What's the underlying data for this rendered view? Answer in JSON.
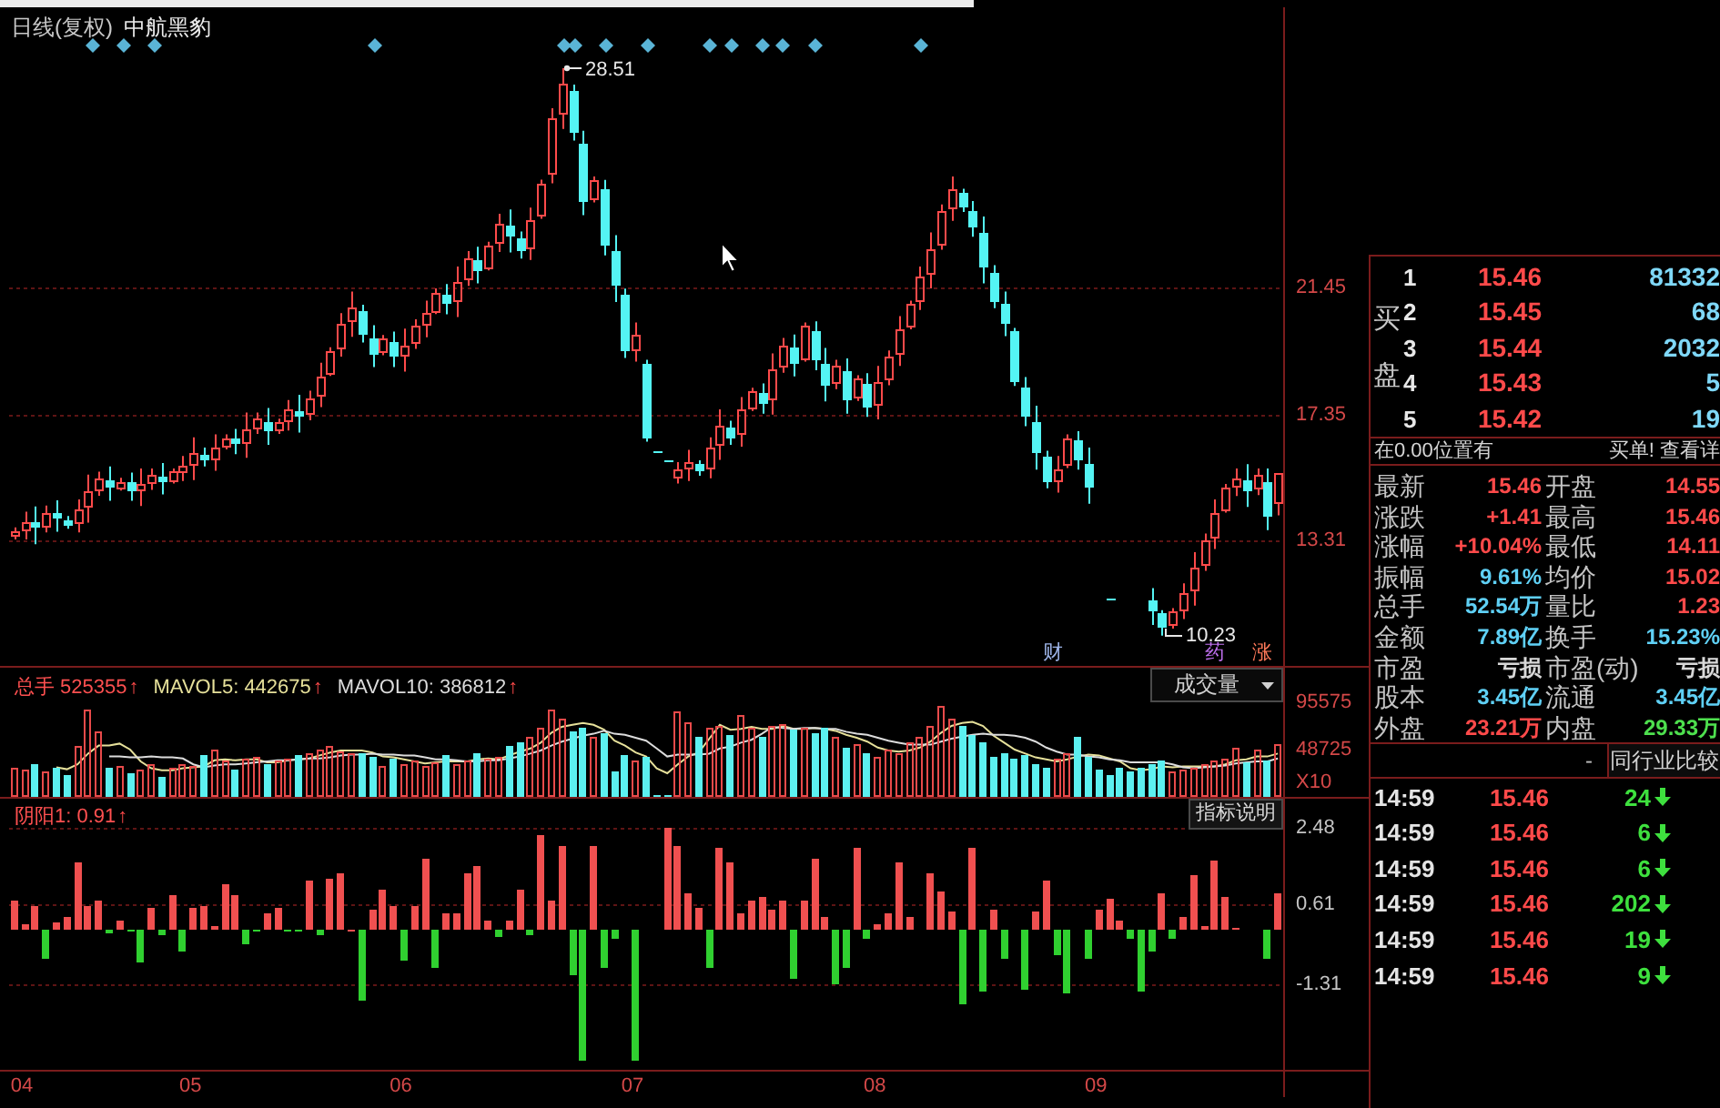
{
  "price_chart": {
    "title": "日线(复权)",
    "stock_name": "中航黑豹",
    "event_tags": [
      {
        "text": "财",
        "color": "#9db4e8"
      },
      {
        "text": "药",
        "color": "#c070f0"
      },
      {
        "text": "涨",
        "color": "#ff7a5a"
      }
    ],
    "chart_data": {
      "type": "candlestick",
      "grid": true,
      "ohlc": [
        [
          13.45,
          13.72,
          13.33,
          13.6
        ],
        [
          13.65,
          14.22,
          13.33,
          13.9
        ],
        [
          13.87,
          14.39,
          13.18,
          13.7
        ],
        [
          13.78,
          14.42,
          13.56,
          14.2
        ],
        [
          14.17,
          14.59,
          13.58,
          14.0
        ],
        [
          13.97,
          14.09,
          13.68,
          13.8
        ],
        [
          13.88,
          14.62,
          13.56,
          14.3
        ],
        [
          14.39,
          15.42,
          13.87,
          14.9
        ],
        [
          14.96,
          15.52,
          14.74,
          15.3
        ],
        [
          15.26,
          15.68,
          14.58,
          15.0
        ],
        [
          15.03,
          15.32,
          14.91,
          15.2
        ],
        [
          15.16,
          15.48,
          14.58,
          14.9
        ],
        [
          14.93,
          15.62,
          14.41,
          15.1
        ],
        [
          15.15,
          15.62,
          14.93,
          15.4
        ],
        [
          15.37,
          15.79,
          14.78,
          15.2
        ],
        [
          15.25,
          15.62,
          15.13,
          15.5
        ],
        [
          15.53,
          16.02,
          15.21,
          15.7
        ],
        [
          15.76,
          16.62,
          15.24,
          16.1
        ],
        [
          16.07,
          16.29,
          15.68,
          15.9
        ],
        [
          15.96,
          16.72,
          15.54,
          16.3
        ],
        [
          16.35,
          16.72,
          16.23,
          16.6
        ],
        [
          16.57,
          16.89,
          16.08,
          16.4
        ],
        [
          16.48,
          17.42,
          15.96,
          16.9
        ],
        [
          16.95,
          17.42,
          16.73,
          17.2
        ],
        [
          17.14,
          17.56,
          16.38,
          16.8
        ],
        [
          16.85,
          17.22,
          16.73,
          17.1
        ],
        [
          17.16,
          17.82,
          16.84,
          17.5
        ],
        [
          17.47,
          17.99,
          16.78,
          17.3
        ],
        [
          17.39,
          18.12,
          17.17,
          17.9
        ],
        [
          18.01,
          19.02,
          17.59,
          18.6
        ],
        [
          18.72,
          19.52,
          18.6,
          19.4
        ],
        [
          19.54,
          20.62,
          19.22,
          20.3
        ],
        [
          20.38,
          21.32,
          19.86,
          20.8
        ],
        [
          20.67,
          20.89,
          19.68,
          19.9
        ],
        [
          19.81,
          20.23,
          18.88,
          19.3
        ],
        [
          19.38,
          19.92,
          19.26,
          19.8
        ],
        [
          19.71,
          20.03,
          18.88,
          19.2
        ],
        [
          19.26,
          20.12,
          18.74,
          19.6
        ],
        [
          19.69,
          20.42,
          19.47,
          20.2
        ],
        [
          20.26,
          21.02,
          19.84,
          20.6
        ],
        [
          20.71,
          21.42,
          20.59,
          21.3
        ],
        [
          21.24,
          21.56,
          20.58,
          20.9
        ],
        [
          21.01,
          22.12,
          20.49,
          21.6
        ],
        [
          21.72,
          22.62,
          21.5,
          22.4
        ],
        [
          22.34,
          22.76,
          21.58,
          22.0
        ],
        [
          22.12,
          22.92,
          22.0,
          22.8
        ],
        [
          22.91,
          23.82,
          22.59,
          23.5
        ],
        [
          23.44,
          23.96,
          22.58,
          23.1
        ],
        [
          23.03,
          23.25,
          22.38,
          22.6
        ],
        [
          22.75,
          24.02,
          22.33,
          23.6
        ],
        [
          23.78,
          24.92,
          23.66,
          24.8
        ],
        [
          25.12,
          27.22,
          24.8,
          26.9
        ],
        [
          27.07,
          28.51,
          26.55,
          28.0
        ],
        [
          27.76,
          27.98,
          26.18,
          26.4
        ],
        [
          26.07,
          26.49,
          23.78,
          24.2
        ],
        [
          24.31,
          25.02,
          24.19,
          24.9
        ],
        [
          24.59,
          24.91,
          22.48,
          22.8
        ],
        [
          22.61,
          23.13,
          20.98,
          21.5
        ],
        [
          21.19,
          21.41,
          19.18,
          19.4
        ],
        [
          19.48,
          20.32,
          19.06,
          19.9
        ],
        [
          19.0,
          19.12,
          16.48,
          16.6
        ],
        [
          16.2,
          16.2,
          16.2,
          16.2
        ],
        [
          15.9,
          15.9,
          15.9,
          15.9
        ],
        [
          15.35,
          15.82,
          15.13,
          15.6
        ],
        [
          15.63,
          16.22,
          15.21,
          15.8
        ],
        [
          15.76,
          15.88,
          15.38,
          15.5
        ],
        [
          15.62,
          16.62,
          15.3,
          16.3
        ],
        [
          16.41,
          17.52,
          15.89,
          17.0
        ],
        [
          16.94,
          17.16,
          16.38,
          16.6
        ],
        [
          16.74,
          17.92,
          16.32,
          17.5
        ],
        [
          17.59,
          18.22,
          17.47,
          18.1
        ],
        [
          18.04,
          18.36,
          17.38,
          17.7
        ],
        [
          17.87,
          19.32,
          17.35,
          18.8
        ],
        [
          18.92,
          19.82,
          18.7,
          19.6
        ],
        [
          19.51,
          19.93,
          18.58,
          19.0
        ],
        [
          19.18,
          20.32,
          19.06,
          20.2
        ],
        [
          20.04,
          20.36,
          18.78,
          19.1
        ],
        [
          18.98,
          19.5,
          17.78,
          18.3
        ],
        [
          18.39,
          19.12,
          18.17,
          18.9
        ],
        [
          18.74,
          19.16,
          17.38,
          17.8
        ],
        [
          17.91,
          18.62,
          17.79,
          18.5
        ],
        [
          18.37,
          18.69,
          17.28,
          17.6
        ],
        [
          17.72,
          18.92,
          17.2,
          18.4
        ],
        [
          18.52,
          19.42,
          18.3,
          19.2
        ],
        [
          19.34,
          20.52,
          18.92,
          20.1
        ],
        [
          20.22,
          21.02,
          20.1,
          20.9
        ],
        [
          21.04,
          22.12,
          20.72,
          21.8
        ],
        [
          21.94,
          23.22,
          21.42,
          22.7
        ],
        [
          22.88,
          24.12,
          22.66,
          23.9
        ],
        [
          24.01,
          25.02,
          23.59,
          24.6
        ],
        [
          24.51,
          24.63,
          23.88,
          24.0
        ],
        [
          23.91,
          24.23,
          23.08,
          23.4
        ],
        [
          23.21,
          23.73,
          21.58,
          22.1
        ],
        [
          21.94,
          22.16,
          20.78,
          21.0
        ],
        [
          20.9,
          21.32,
          19.88,
          20.3
        ],
        [
          20.02,
          20.14,
          18.28,
          18.4
        ],
        [
          18.24,
          18.56,
          16.98,
          17.3
        ],
        [
          17.12,
          17.64,
          15.58,
          16.1
        ],
        [
          15.97,
          16.19,
          14.98,
          15.2
        ],
        [
          15.26,
          16.02,
          14.84,
          15.6
        ],
        [
          15.75,
          16.72,
          15.63,
          16.6
        ],
        [
          16.5,
          16.82,
          15.58,
          15.9
        ],
        [
          15.77,
          16.29,
          14.48,
          15.0
        ],
        null,
        [
          11.4,
          11.4,
          11.4,
          11.4
        ],
        null,
        null,
        null,
        [
          11.34,
          11.76,
          10.58,
          11.0
        ],
        [
          10.93,
          11.05,
          10.23,
          10.5
        ],
        [
          10.58,
          11.12,
          10.46,
          11.0
        ],
        [
          11.09,
          11.92,
          10.77,
          11.6
        ],
        [
          11.72,
          12.92,
          11.2,
          12.4
        ],
        [
          12.54,
          13.52,
          12.32,
          13.3
        ],
        [
          13.44,
          14.62,
          13.02,
          14.2
        ],
        [
          14.32,
          15.12,
          14.2,
          15.0
        ],
        [
          15.05,
          15.62,
          14.73,
          15.3
        ],
        [
          15.24,
          15.76,
          14.38,
          14.9
        ],
        [
          14.98,
          15.62,
          14.76,
          15.4
        ],
        [
          15.2,
          15.62,
          13.63,
          14.05
        ],
        [
          14.55,
          15.46,
          14.11,
          15.46
        ]
      ],
      "ylim": [
        9.26,
        30.47
      ],
      "yticks": [
        13.31,
        17.35,
        21.45
      ],
      "annotations": [
        {
          "text": "28.51"
        },
        {
          "text": "10.23"
        }
      ]
    }
  },
  "volume_panel": {
    "legend": [
      {
        "text": "总手 525355",
        "arrow": "↑",
        "color": "#ff5050"
      },
      {
        "text": "MAVOL5: 442675",
        "arrow": "↑",
        "color": "#e6e09a"
      },
      {
        "text": "MAVOL10: 386812",
        "arrow": "↑",
        "color": "#dcdcdc"
      }
    ],
    "dropdown": "成交量",
    "axis_unit": "X10",
    "chart_data": {
      "type": "bar",
      "stacked": true,
      "ylim": [
        0,
        131000
      ],
      "yticks": [
        48725,
        95575
      ],
      "series": [
        {
          "color": "#e84a4a",
          "values": [
            30000,
            28000,
            null,
            26000,
            null,
            null,
            52000,
            88000,
            66000,
            null,
            32000,
            null,
            28000,
            33000,
            null,
            30000,
            34000,
            31000,
            null,
            48000,
            36000,
            null,
            38000,
            40000,
            null,
            36000,
            38000,
            null,
            45000,
            48000,
            52000,
            46000,
            44000,
            null,
            null,
            32000,
            null,
            34000,
            36000,
            32000,
            35000,
            null,
            33000,
            36000,
            null,
            38000,
            40000,
            null,
            null,
            60000,
            70000,
            88000,
            80000,
            null,
            null,
            60000,
            null,
            null,
            null,
            36000,
            null,
            null,
            null,
            86000,
            75000,
            null,
            70000,
            72000,
            null,
            83000,
            70000,
            null,
            72000,
            74000,
            null,
            70000,
            null,
            null,
            60000,
            null,
            54000,
            null,
            40000,
            48000,
            45000,
            55000,
            60000,
            72000,
            92000,
            80000,
            null,
            null,
            null,
            null,
            null,
            null,
            null,
            null,
            null,
            38000,
            45000,
            null,
            null,
            null,
            null,
            null,
            null,
            null,
            null,
            null,
            26000,
            28000,
            30000,
            33000,
            36000,
            38000,
            50000,
            null,
            48000,
            null,
            53000
          ]
        },
        {
          "color": "#5cf0f0",
          "values": [
            null,
            null,
            34000,
            null,
            30000,
            22000,
            null,
            null,
            null,
            30000,
            null,
            24000,
            null,
            null,
            20000,
            null,
            null,
            null,
            42000,
            null,
            null,
            28000,
            null,
            null,
            34000,
            null,
            null,
            42000,
            null,
            null,
            null,
            null,
            null,
            45000,
            40000,
            null,
            38000,
            null,
            null,
            null,
            null,
            42000,
            null,
            null,
            44000,
            null,
            null,
            52000,
            55000,
            null,
            null,
            null,
            null,
            66000,
            70000,
            null,
            64000,
            25000,
            42000,
            null,
            40000,
            2000,
            2000,
            null,
            null,
            60000,
            null,
            null,
            62000,
            null,
            null,
            60000,
            null,
            null,
            68000,
            null,
            65000,
            70000,
            null,
            50000,
            null,
            45000,
            null,
            null,
            null,
            null,
            null,
            null,
            null,
            null,
            72000,
            62000,
            55000,
            40000,
            45000,
            38000,
            42000,
            34000,
            30000,
            null,
            null,
            60000,
            40000,
            28000,
            22000,
            30000,
            26000,
            30000,
            34000,
            36000,
            null,
            null,
            null,
            null,
            null,
            null,
            null,
            35000,
            null,
            36000,
            null
          ]
        },
        {
          "type": "line",
          "color": "#e6e09a",
          "values": [
            null,
            null,
            null,
            null,
            30000,
            28000,
            33000,
            44000,
            52000,
            52000,
            54000,
            48000,
            36000,
            29000,
            27000,
            27000,
            29000,
            30000,
            31000,
            37000,
            38000,
            37000,
            38000,
            38000,
            35000,
            35000,
            37000,
            38000,
            39000,
            42000,
            45000,
            47000,
            47000,
            47000,
            45000,
            41000,
            40000,
            38000,
            36000,
            34000,
            35000,
            36000,
            36000,
            36000,
            38000,
            39000,
            38000,
            42000,
            46000,
            49000,
            55000,
            65000,
            71000,
            73000,
            75000,
            73000,
            68000,
            57000,
            52000,
            45000,
            41000,
            29000,
            24000,
            33000,
            41000,
            45000,
            59000,
            73000,
            68000,
            69000,
            71000,
            69000,
            69000,
            72000,
            69000,
            69000,
            70000,
            69000,
            67000,
            63000,
            60000,
            56000,
            50000,
            47000,
            46000,
            47000,
            50000,
            56000,
            65000,
            72000,
            75000,
            76000,
            72000,
            62000,
            55000,
            48000,
            44000,
            40000,
            38000,
            36000,
            38000,
            41000,
            43000,
            42000,
            39000,
            36000,
            29000,
            27000,
            28000,
            31000,
            30000,
            31000,
            31000,
            31000,
            31000,
            33000,
            37000,
            38000,
            41000,
            41000,
            44000
          ]
        },
        {
          "type": "line",
          "color": "#dcdcdc",
          "values": [
            null,
            null,
            null,
            null,
            null,
            null,
            null,
            null,
            null,
            41000,
            41000,
            40000,
            40000,
            41000,
            40000,
            40000,
            39000,
            33000,
            30000,
            32000,
            33000,
            33000,
            34000,
            35000,
            36000,
            37000,
            37000,
            38000,
            39000,
            39000,
            40000,
            42000,
            43000,
            43000,
            44000,
            43000,
            43000,
            42000,
            42000,
            40000,
            38000,
            38000,
            37000,
            36000,
            36000,
            37000,
            37000,
            39000,
            41000,
            44000,
            47000,
            52000,
            56000,
            59000,
            62000,
            64000,
            67000,
            64000,
            63000,
            60000,
            57000,
            49000,
            41000,
            43000,
            43000,
            43000,
            44000,
            49000,
            51000,
            55000,
            58000,
            64000,
            71000,
            70000,
            69000,
            70000,
            70000,
            69000,
            69000,
            66000,
            64000,
            63000,
            60000,
            57000,
            55000,
            53000,
            53000,
            53000,
            56000,
            59000,
            61000,
            63000,
            64000,
            63000,
            63000,
            62000,
            60000,
            56000,
            50000,
            46000,
            43000,
            43000,
            41000,
            40000,
            38000,
            37000,
            35000,
            35000,
            35000,
            35000,
            33000,
            30000,
            29000,
            30000,
            31000,
            32000,
            34000,
            35000,
            36000,
            36000,
            39000
          ]
        }
      ]
    }
  },
  "indicator_panel": {
    "legend": {
      "text": "阴阳1: 0.91",
      "arrow": "↑"
    },
    "button": "指标说明",
    "chart_data": {
      "type": "bar",
      "grid": true,
      "ylim": [
        -3.4,
        3.2
      ],
      "yticks": [
        -1.31,
        0.61,
        2.48
      ],
      "series": [
        {
          "color": "#f05050",
          "values": [
            0.7,
            0.16,
            0.6,
            null,
            0.2,
            0.34,
            1.64,
            0.6,
            0.7,
            null,
            0.24,
            null,
            null,
            0.54,
            null,
            0.84,
            null,
            0.54,
            0.6,
            0.1,
            1.1,
            0.84,
            null,
            null,
            0.4,
            0.54,
            null,
            null,
            1.2,
            null,
            1.24,
            1.4,
            0.02,
            null,
            0.5,
            1.0,
            0.6,
            null,
            0.6,
            1.74,
            null,
            0.4,
            0.4,
            1.4,
            1.56,
            0.24,
            null,
            0.24,
            1.0,
            null,
            2.3,
            0.7,
            2.06,
            null,
            null,
            2.06,
            null,
            null,
            null,
            null,
            null,
            null,
            2.5,
            2.06,
            0.9,
            0.54,
            null,
            2.0,
            1.64,
            0.4,
            0.7,
            0.8,
            0.5,
            0.7,
            null,
            0.7,
            1.74,
            0.34,
            null,
            null,
            2.0,
            null,
            0.14,
            0.4,
            1.64,
            0.3,
            null,
            1.4,
            0.96,
            0.44,
            null,
            2.0,
            null,
            0.5,
            null,
            null,
            null,
            0.44,
            1.2,
            null,
            null,
            null,
            null,
            0.5,
            0.76,
            0.24,
            null,
            null,
            null,
            0.9,
            null,
            0.34,
            1.36,
            0.1,
            1.7,
            0.8,
            0.06,
            null,
            null,
            null,
            0.91
          ]
        },
        {
          "color": "#30d030",
          "values": [
            null,
            null,
            null,
            -0.7,
            null,
            null,
            null,
            null,
            null,
            -0.06,
            null,
            -0.05,
            -0.8,
            null,
            -0.1,
            null,
            -0.5,
            null,
            null,
            null,
            null,
            null,
            -0.36,
            -0.04,
            null,
            null,
            -0.04,
            -0.04,
            null,
            -0.1,
            null,
            null,
            null,
            -1.7,
            null,
            null,
            null,
            -0.76,
            null,
            null,
            -0.9,
            null,
            null,
            null,
            null,
            null,
            -0.16,
            null,
            null,
            -0.1,
            null,
            null,
            null,
            -1.1,
            -3.16,
            null,
            -0.9,
            -0.2,
            null,
            -3.16,
            null,
            null,
            null,
            null,
            null,
            null,
            -0.9,
            null,
            null,
            null,
            null,
            null,
            null,
            null,
            -1.2,
            null,
            null,
            null,
            -1.3,
            -0.9,
            null,
            -0.2,
            null,
            null,
            null,
            null,
            null,
            null,
            null,
            null,
            -1.8,
            null,
            -1.5,
            null,
            -0.7,
            null,
            -1.44,
            null,
            null,
            -0.6,
            -1.56,
            null,
            -0.7,
            null,
            null,
            null,
            -0.2,
            -1.5,
            -0.5,
            null,
            -0.2,
            null,
            null,
            null,
            null,
            null,
            null,
            null,
            null,
            -0.7,
            null
          ]
        }
      ]
    }
  },
  "date_axis": [
    "04",
    "05",
    "06",
    "07",
    "08",
    "09"
  ],
  "quote_panel": {
    "order_book": {
      "side_label": "买盘",
      "rows": [
        {
          "rank": "1",
          "price": "15.46",
          "volume": "81332"
        },
        {
          "rank": "2",
          "price": "15.45",
          "volume": "68"
        },
        {
          "rank": "3",
          "price": "15.44",
          "volume": "2032"
        },
        {
          "rank": "4",
          "price": "15.43",
          "volume": "5"
        },
        {
          "rank": "5",
          "price": "15.42",
          "volume": "19"
        }
      ]
    },
    "notice": {
      "text": "在0.00位置有",
      "link": "买单! 查看详"
    },
    "stats": [
      {
        "label": "最新",
        "value": "15.46",
        "color": "#ff4a4a"
      },
      {
        "label": "开盘",
        "value": "14.55",
        "color": "#ff4a4a"
      },
      {
        "label": "涨跌",
        "value": "+1.41",
        "color": "#ff4a4a"
      },
      {
        "label": "最高",
        "value": "15.46",
        "color": "#ff4a4a"
      },
      {
        "label": "涨幅",
        "value": "+10.04%",
        "color": "#ff4a4a"
      },
      {
        "label": "最低",
        "value": "14.11",
        "color": "#ff4a4a"
      },
      {
        "label": "振幅",
        "value": "9.61%",
        "color": "#5fd0f5"
      },
      {
        "label": "均价",
        "value": "15.02",
        "color": "#ff4a4a"
      },
      {
        "label": "总手",
        "value": "52.54万",
        "color": "#5fd0f5"
      },
      {
        "label": "量比",
        "value": "1.23",
        "color": "#ff4a4a"
      },
      {
        "label": "金额",
        "value": "7.89亿",
        "color": "#5fd0f5"
      },
      {
        "label": "换手",
        "value": "15.23%",
        "color": "#5fd0f5"
      },
      {
        "label": "市盈",
        "value": "亏损",
        "color": "#d8d8d8"
      },
      {
        "label": "市盈(动)",
        "value": "亏损",
        "color": "#d8d8d8"
      },
      {
        "label": "股本",
        "value": "3.45亿",
        "color": "#5fd0f5"
      },
      {
        "label": "流通",
        "value": "3.45亿",
        "color": "#5fd0f5"
      },
      {
        "label": "外盘",
        "value": "23.21万",
        "color": "#ff4a4a"
      },
      {
        "label": "内盘",
        "value": "29.33万",
        "color": "#4ee04e"
      }
    ],
    "compare": {
      "dash": "-",
      "tab": "同行业比较"
    },
    "trades": [
      {
        "time": "14:59",
        "price": "15.46",
        "volume": "24",
        "down": true
      },
      {
        "time": "14:59",
        "price": "15.46",
        "volume": "6",
        "down": true
      },
      {
        "time": "14:59",
        "price": "15.46",
        "volume": "6",
        "down": true
      },
      {
        "time": "14:59",
        "price": "15.46",
        "volume": "202",
        "down": true
      },
      {
        "time": "14:59",
        "price": "15.46",
        "volume": "19",
        "down": true
      },
      {
        "time": "14:59",
        "price": "15.46",
        "volume": "9",
        "down": true
      }
    ]
  }
}
